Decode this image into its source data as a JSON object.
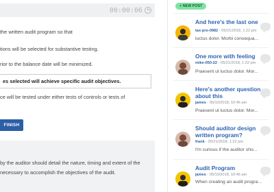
{
  "quiz": {
    "timer": "00:00:06",
    "options": [
      {
        "text": "the written audit program so that"
      },
      {
        "text": "tions will be selected for substantive testing."
      },
      {
        "text": "rior to the balance date will be minimized."
      },
      {
        "text": "es selected will achieve specific audit objectives.",
        "selected": true
      },
      {
        "text": "ce will be tested under either tests of controls or tests of"
      },
      {
        "text": ""
      }
    ],
    "finish_label": "FINISH",
    "feedback": [
      "by the auditor should detail the nature, timing and extent of the",
      "necessary to accomplish the objectives of the audit."
    ]
  },
  "sidebar": {
    "new_post_label": "+ NEW POST",
    "posts": [
      {
        "title_line1": "And here's the last one",
        "title_line2": "",
        "user": "tax-pro-0982",
        "meta": " - 05/21/2018, 1:22 pm",
        "excerpt": "luctus dolor. Morbi consequa...",
        "avatar_color": "#f4b400",
        "icon": "speech-bubble-icon"
      },
      {
        "title_line1": "One more with feeling",
        "title_line2": "",
        "user": "mike-050-22",
        "meta": " - 05/21/2018, 1:22 pm",
        "excerpt": "Praesent ut luctus dolor. Mor...",
        "avatar_color": "#c88a7a",
        "icon": "speech-bubble-icon"
      },
      {
        "title_line1": "Here's another question",
        "title_line2": "about this",
        "user": "james",
        "meta": " - 05/10/2018, 10:46 am",
        "excerpt": "Praesent ut luctus dolor. Mor...",
        "avatar_color": "#f4c400",
        "icon": "speech-bubble-icon"
      },
      {
        "title_line1": "Should auditor design",
        "title_line2": "written program?",
        "user": "frank",
        "meta": " - 05/21/2018, 1:22 pm",
        "excerpt": "I'm curious if the auditor sho...",
        "avatar_color": "#c88a7a",
        "icon": "speech-bubble-icon"
      },
      {
        "title_line1": "Audit Program",
        "title_line2": "",
        "user": "james",
        "meta": " - 05/10/2018, 10:46 am",
        "excerpt": "When creating an audit progra...",
        "avatar_color": "#f4c400",
        "icon": "speech-bubble-icon"
      }
    ]
  }
}
